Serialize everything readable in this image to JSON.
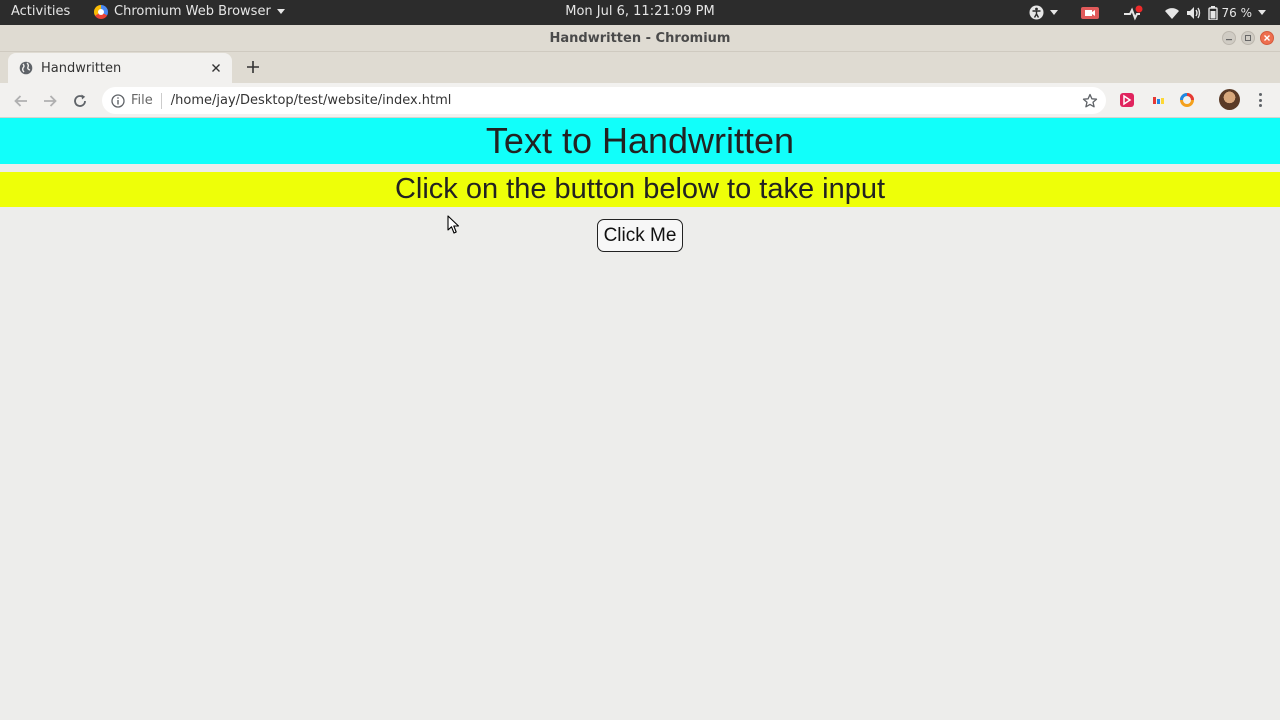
{
  "topbar": {
    "activities": "Activities",
    "app_name": "Chromium Web Browser",
    "clock": "Mon Jul  6, 11:21:09 PM",
    "battery": "76 %"
  },
  "window": {
    "title": "Handwritten - Chromium"
  },
  "tabs": [
    {
      "label": "Handwritten"
    }
  ],
  "omnibox": {
    "scheme_label": "File",
    "url": "/home/jay/Desktop/test/website/index.html"
  },
  "page": {
    "heading": "Text to Handwritten",
    "subheading": "Click on the button below to take input",
    "button_label": "Click Me"
  },
  "colors": {
    "heading_bg": "#11fffa",
    "subheading_bg": "#eeff08",
    "page_bg": "#ededeb",
    "topbar_bg": "#2c2c2c"
  }
}
